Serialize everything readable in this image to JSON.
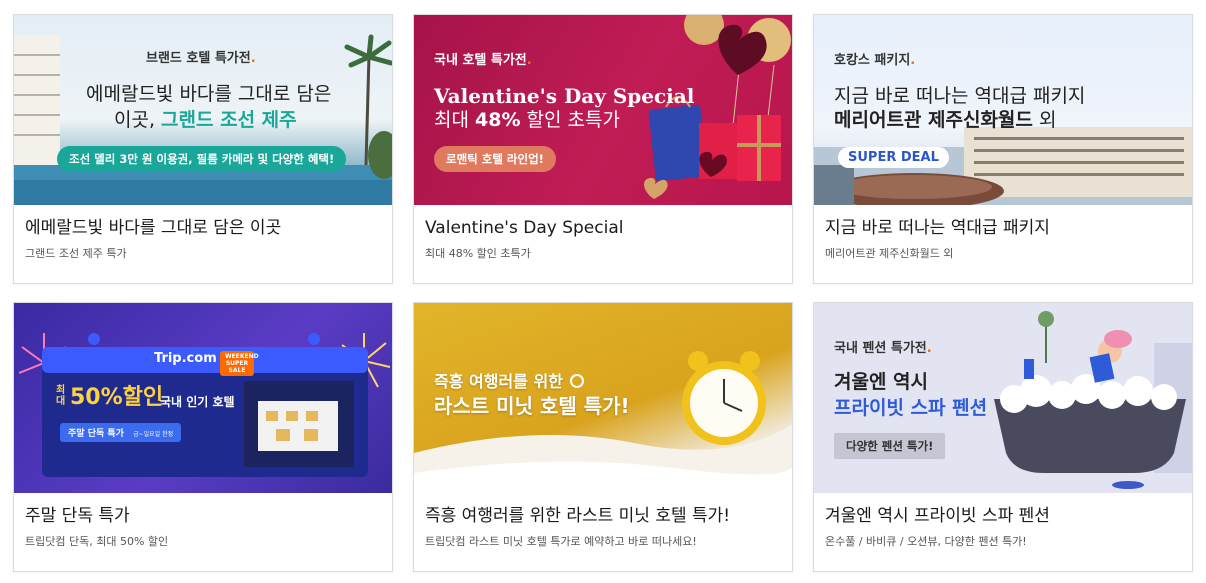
{
  "cards": [
    {
      "banner": {
        "eyebrow": "브랜드 호텔 특가전",
        "line1": "에메랄드빛 바다를 그대로 담은",
        "line2_prefix": "이곳, ",
        "line2_highlight": "그랜드 조선 제주",
        "pill": "조선 델리 3만 원 이용권, 필름 카메라 및 다양한 혜택!"
      },
      "title": "에메랄드빛 바다를 그대로 담은 이곳",
      "subtitle": "그랜드 조선 제주 특가"
    },
    {
      "banner": {
        "eyebrow": "국내 호텔 특가전",
        "headline": "Valentine's Day Special",
        "line2_prefix": "최대 ",
        "line2_bold": "48%",
        "line2_suffix": " 할인 초특가",
        "pill": "로맨틱 호텔 라인업!"
      },
      "title": "Valentine's Day Special",
      "subtitle": "최대 48% 할인 초특가"
    },
    {
      "banner": {
        "eyebrow": "호캉스 패키지",
        "line1": "지금 바로 떠나는 역대급 패키지",
        "line2_bold": "메리어트관 제주신화월드",
        "line2_suffix": " 외",
        "badge": "SUPER DEAL"
      },
      "title": "지금 바로 떠나는 역대급 패키지",
      "subtitle": "메리어트관 제주신화월드 외"
    },
    {
      "banner": {
        "brand": "Trip.com",
        "sale_tag": "WEEKEND SUPER SALE",
        "max_label": "최대",
        "discount": "50%할인",
        "tagline": "국내 인기 호텔",
        "chip": "주말 단독 특가",
        "chip_small": "금~일요일 한정"
      },
      "title": "주말 단독 특가",
      "subtitle": "트립닷컴 단독, 최대 50% 할인"
    },
    {
      "banner": {
        "line1": "즉흥 여행러를 위한",
        "line2": "라스트 미닛 호텔 특가!"
      },
      "title": "즉흥 여행러를 위한 라스트 미닛 호텔 특가!",
      "subtitle": "트립닷컴 라스트 미닛 호텔 특가로 예약하고 바로 떠나세요!"
    },
    {
      "banner": {
        "eyebrow": "국내 펜션 특가전",
        "line1": "겨울엔 역시",
        "line2": "프라이빗 스파 펜션",
        "pill": "다양한 펜션 특가!"
      },
      "title": "겨울엔 역시 프라이빗 스파 펜션",
      "subtitle": "온수풀 / 바비큐 / 오션뷰, 다양한 펜션 특가!"
    }
  ],
  "colors": {
    "highlight_teal": "#1aa79a",
    "accent_orange": "#ff6a00",
    "valentine_bg": "#b8174e",
    "spa_blue": "#2f5bd9",
    "super_deal_blue": "#2a56c9"
  }
}
